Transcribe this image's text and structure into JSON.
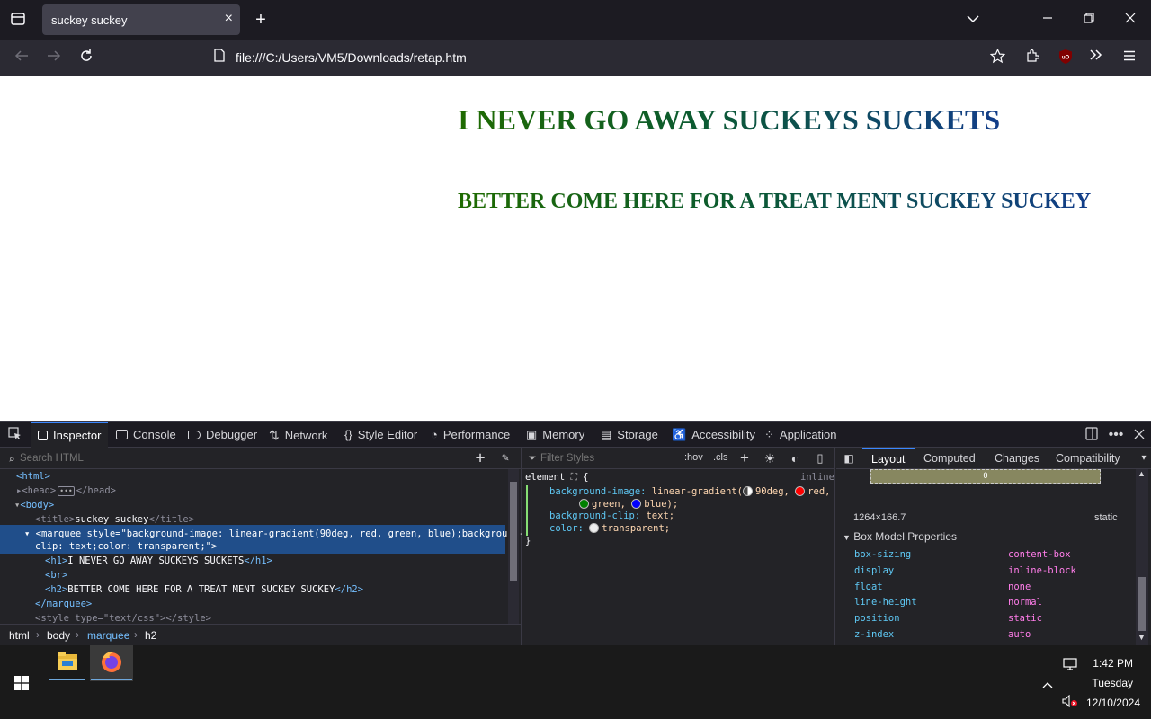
{
  "tab": {
    "title": "suckey suckey",
    "close_icon": "×"
  },
  "nav": {
    "url": "file:///C:/Users/VM5/Downloads/retap.htm"
  },
  "page": {
    "h1": "I NEVER GO AWAY SUCKEYS SUCKETS",
    "h2": "BETTER COME HERE FOR A TREAT MENT SUCKEY SUCKEY"
  },
  "devtools": {
    "tabs": [
      "Inspector",
      "Console",
      "Debugger",
      "Network",
      "Style Editor",
      "Performance",
      "Memory",
      "Storage",
      "Accessibility",
      "Application"
    ],
    "search_placeholder": "Search HTML",
    "filter_placeholder": "Filter Styles",
    "hov": ":hov",
    "cls": ".cls",
    "html_lines": {
      "html_open": "<html>",
      "head": "<head>",
      "head_close": "</head>",
      "body": "<body>",
      "title_open": "<title>",
      "title_text": "suckey suckey",
      "title_close": "</title>",
      "marquee_line1": "<marquee style=\"background-image: linear-gradient(90deg, red, green, blue);background-",
      "marquee_line2": "clip: text;color: transparent;\">",
      "h1_open": "<h1>",
      "h1_text": "I NEVER GO AWAY SUCKEYS SUCKETS",
      "h1_close": "</h1>",
      "br": "<br>",
      "h2_open": "<h2>",
      "h2_text": "BETTER COME HERE FOR A TREAT MENT SUCKEY SUCKEY",
      "h2_close": "</h2>",
      "marquee_close": "</marquee>",
      "style_line": "<style type=\"text/css\"></style>"
    },
    "breadcrumb": [
      "html",
      "body",
      "marquee",
      "h2"
    ],
    "rules": {
      "selector": "element",
      "brace_open": "{",
      "source": "inline",
      "bg_prop": "background-image:",
      "bg_func": "linear-gradient(",
      "bg_angle": "90deg,",
      "bg_red": "red,",
      "bg_green": "green,",
      "bg_blue": "blue);",
      "clip_prop": "background-clip:",
      "clip_val": "text;",
      "color_prop": "color:",
      "color_val": "transparent;",
      "brace_close": "}"
    },
    "layout_tabs": [
      "Layout",
      "Computed",
      "Changes",
      "Compatibility"
    ],
    "box_model": {
      "margin_value": "0",
      "size": "1264×166.7",
      "position": "static",
      "section_title": "Box Model Properties",
      "props": [
        {
          "k": "box-sizing",
          "v": "content-box"
        },
        {
          "k": "display",
          "v": "inline-block"
        },
        {
          "k": "float",
          "v": "none"
        },
        {
          "k": "line-height",
          "v": "normal"
        },
        {
          "k": "position",
          "v": "static"
        },
        {
          "k": "z-index",
          "v": "auto"
        }
      ]
    }
  },
  "taskbar": {
    "time": "1:42 PM",
    "day": "Tuesday",
    "date": "12/10/2024"
  },
  "colors": {
    "accent": "#3a87ff",
    "selected_row": "#204e8a"
  }
}
